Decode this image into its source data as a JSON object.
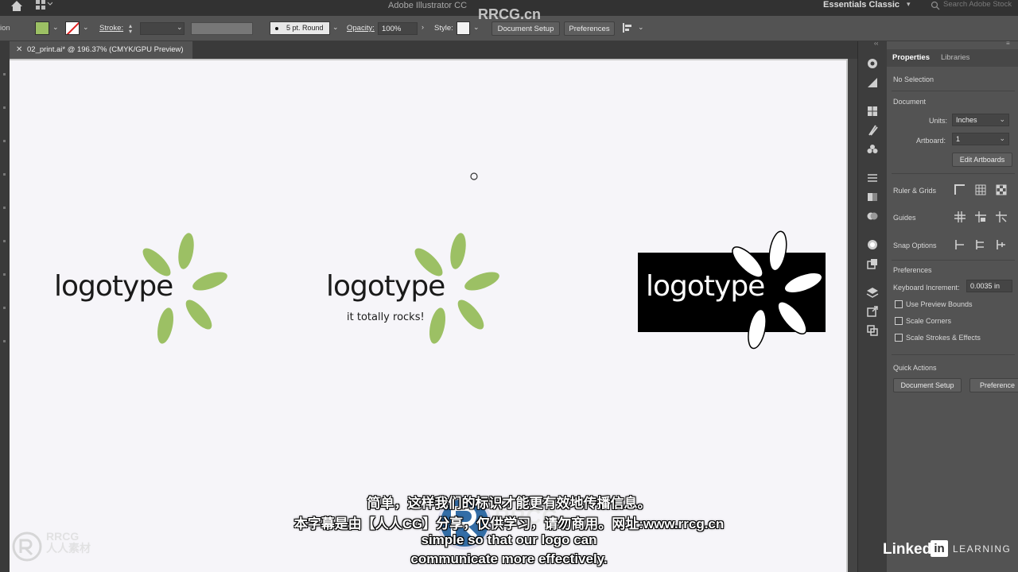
{
  "titlebar": {
    "app_title": "Adobe Illustrator CC",
    "workspace": "Essentials Classic",
    "search_placeholder": "Search Adobe Stock"
  },
  "controlbar": {
    "left_cut_label": "ion",
    "fill_color": "#9cc064",
    "stroke_label": "Stroke:",
    "brush_label": "5 pt. Round",
    "opacity_label": "Opacity:",
    "opacity_value": "100%",
    "style_label": "Style:",
    "document_setup_button": "Document Setup",
    "preferences_button": "Preferences"
  },
  "document": {
    "tab_title": "02_print.ai* @ 196.37% (CMYK/GPU Preview)"
  },
  "artboard": {
    "logos": [
      {
        "wordmark": "logotype",
        "tagline": ""
      },
      {
        "wordmark": "logotype",
        "tagline": "it totally rocks!"
      },
      {
        "wordmark": "logotype",
        "tagline": ""
      }
    ],
    "leaf_color": "#9cc064"
  },
  "properties_panel": {
    "tabs": [
      "Properties",
      "Libraries"
    ],
    "selection_status": "No Selection",
    "document_heading": "Document",
    "units_label": "Units:",
    "units_value": "Inches",
    "artboard_label": "Artboard:",
    "artboard_value": "1",
    "edit_artboards_button": "Edit Artboards",
    "ruler_grids_label": "Ruler & Grids",
    "guides_label": "Guides",
    "snap_options_label": "Snap Options",
    "preferences_heading": "Preferences",
    "keyboard_increment_label": "Keyboard Increment:",
    "keyboard_increment_value": "0.0035 in",
    "checkboxes": [
      "Use Preview Bounds",
      "Scale Corners",
      "Scale Strokes & Effects"
    ],
    "quick_actions_heading": "Quick Actions",
    "quick_action_buttons": [
      "Document Setup",
      "Preference"
    ]
  },
  "subtitles": {
    "line1_zh": "简单，这样我们的标识才能更有效地传播信息。",
    "line2_zh": "本字幕是由【人人CG】分享，仅供学习，请勿商用。网址:www.rrcg.cn",
    "line3_en": "simple so that our logo can",
    "line4_en": "communicate more effectively."
  },
  "branding": {
    "watermark_top": "RRCG.cn",
    "watermark_center": "RRCG",
    "watermark_bl_line1": "RRCG",
    "watermark_bl_line2": "人人素材",
    "linkedin_word": "Linked",
    "linkedin_in": "in",
    "learning_word": "LEARNING"
  }
}
